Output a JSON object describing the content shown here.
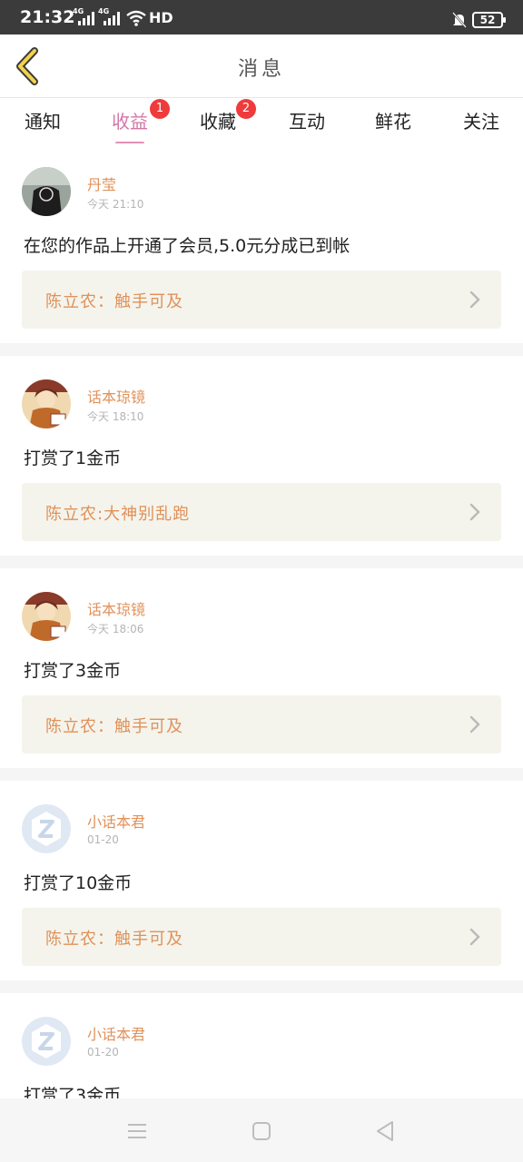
{
  "status_bar": {
    "time": "21:32",
    "net1": "4G",
    "net2": "4G",
    "hd": "HD",
    "battery": "52"
  },
  "header": {
    "title": "消息"
  },
  "tabs": [
    {
      "label": "通知",
      "badge": ""
    },
    {
      "label": "收益",
      "badge": "1"
    },
    {
      "label": "收藏",
      "badge": "2"
    },
    {
      "label": "互动",
      "badge": ""
    },
    {
      "label": "鲜花",
      "badge": ""
    },
    {
      "label": "关注",
      "badge": ""
    }
  ],
  "active_tab": "收益",
  "colors": {
    "accent_pink": "#d277a8",
    "name_orange": "#e0915a",
    "badge_red": "#ef3b3b",
    "quote_bg": "#f4f4ec"
  },
  "items": [
    {
      "avatar": "dark-photo-avatar",
      "name": "丹莹",
      "time": "今天 21:10",
      "message": "在您的作品上开通了会员,5.0元分成已到帐",
      "quote": "陈立农：触手可及"
    },
    {
      "avatar": "illustrated-avatar",
      "name": "话本琼镜",
      "time": "今天 18:10",
      "message": "打赏了1金币",
      "quote": "陈立农:大神别乱跑"
    },
    {
      "avatar": "illustrated-avatar",
      "name": "话本琼镜",
      "time": "今天 18:06",
      "message": "打赏了3金币",
      "quote": "陈立农：触手可及"
    },
    {
      "avatar": "default-z-avatar",
      "name": "小话本君",
      "time": "01-20",
      "message": "打赏了10金币",
      "quote": "陈立农：触手可及"
    },
    {
      "avatar": "default-z-avatar",
      "name": "小话本君",
      "time": "01-20",
      "message": "打赏了3金币",
      "quote": ""
    }
  ]
}
